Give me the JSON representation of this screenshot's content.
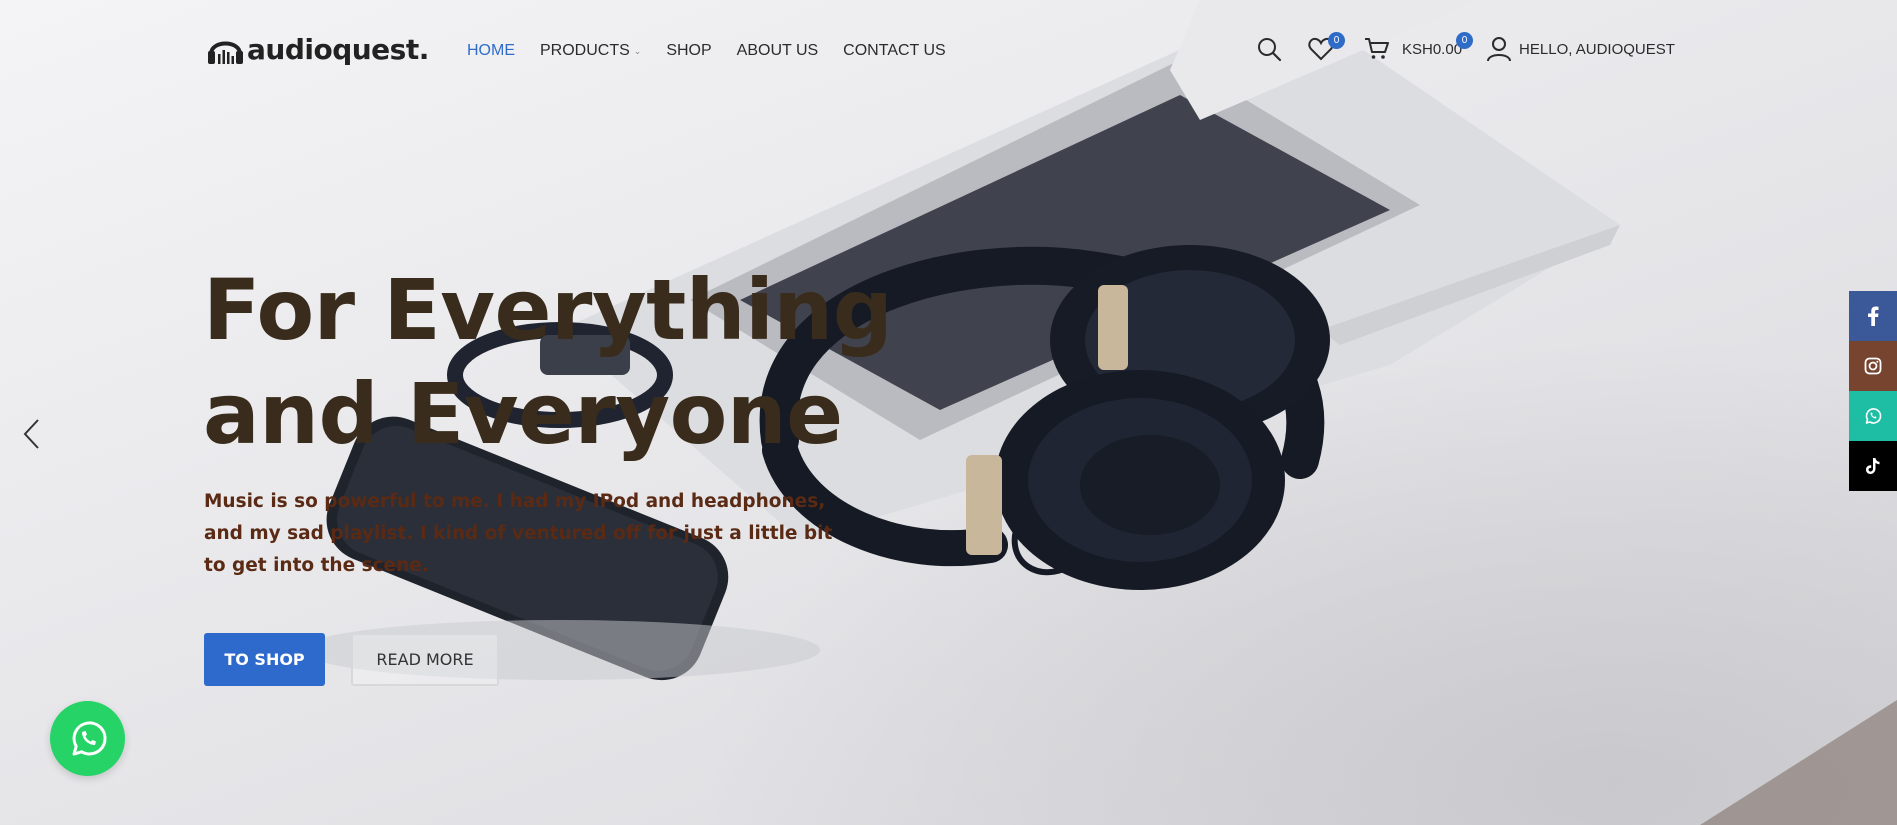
{
  "header": {
    "logo_text": "audioquest.",
    "nav": [
      {
        "label": "HOME",
        "active": true
      },
      {
        "label": "PRODUCTS",
        "has_dropdown": true
      },
      {
        "label": "SHOP"
      },
      {
        "label": "ABOUT US"
      },
      {
        "label": "CONTACT US"
      }
    ],
    "wishlist_count": "0",
    "cart_count": "0",
    "cart_total": "KSH0.00",
    "account_label": "HELLO, AUDIOQUEST"
  },
  "hero": {
    "headline_line1": "For Everything",
    "headline_line2": "and Everyone",
    "subtext": "Music is so powerful to me. I had my IPod and headphones, and my sad playlist. I kind of ventured off for just a little bit to get into the scene.",
    "primary_button": "TO SHOP",
    "secondary_button": "READ MORE"
  },
  "social": [
    "facebook-icon",
    "instagram-icon",
    "whatsapp-icon",
    "tiktok-icon"
  ],
  "colors": {
    "accent": "#2f6cc8",
    "headline": "#3a2c1c",
    "subtext": "#5a2a14",
    "facebook": "#3b5998",
    "instagram": "#774430",
    "whatsapp_side": "#1ebea5",
    "tiktok": "#000000",
    "whatsapp_float": "#25d366"
  }
}
